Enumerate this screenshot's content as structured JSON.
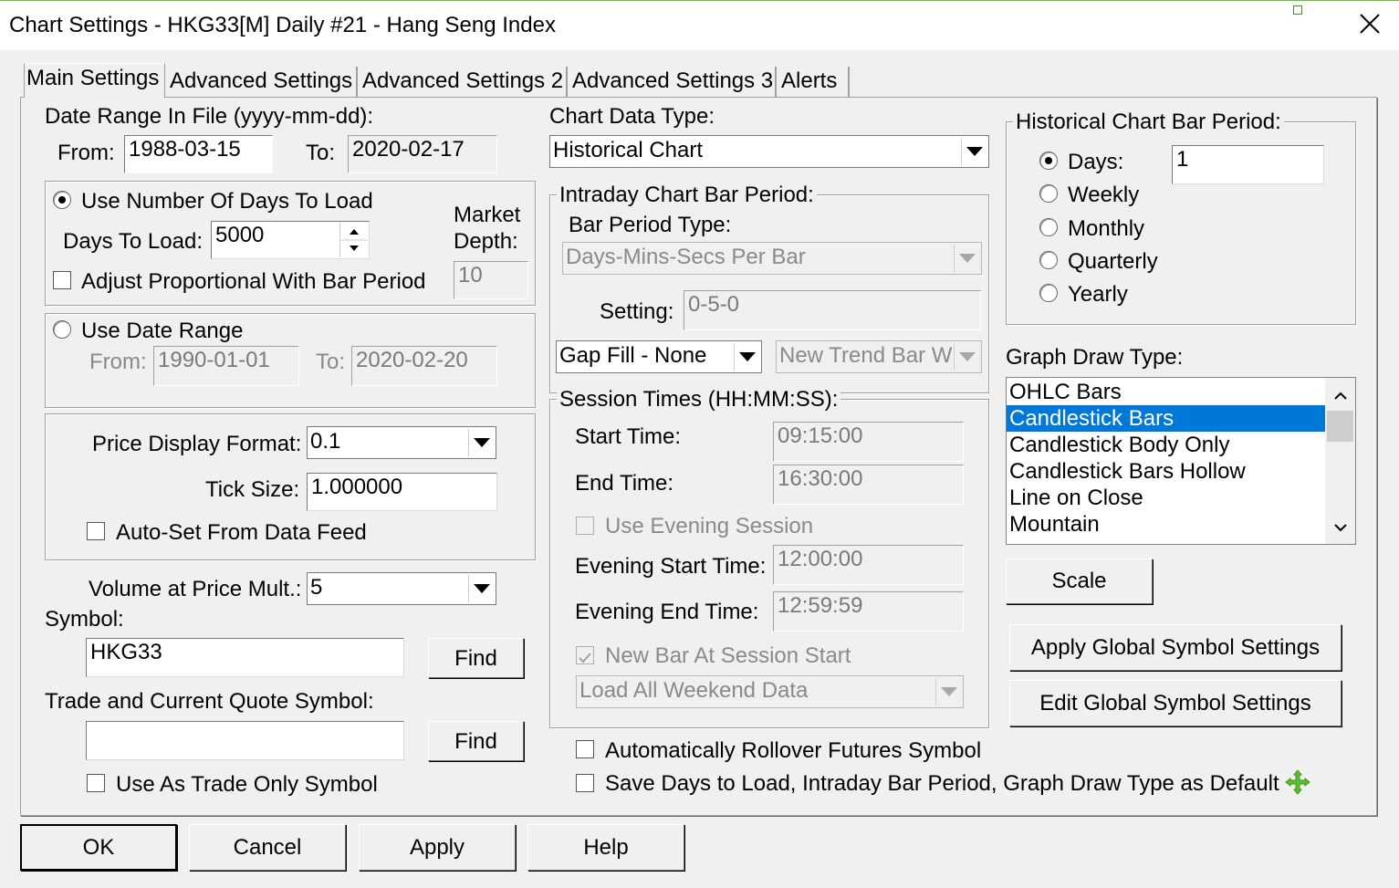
{
  "window": {
    "title": "Chart Settings - HKG33[M]  Daily  #21 - Hang Seng Index"
  },
  "tabs": [
    "Main Settings",
    "Advanced Settings",
    "Advanced Settings 2",
    "Advanced Settings 3",
    "Alerts"
  ],
  "date_range": {
    "label": "Date Range In File (yyyy-mm-dd):",
    "from_label": "From:",
    "from": "1988-03-15",
    "to_label": "To:",
    "to": "2020-02-17"
  },
  "days_group": {
    "use_days_label": "Use Number Of Days To Load",
    "days_label": "Days To Load:",
    "days_value": "5000",
    "market_depth_label_1": "Market",
    "market_depth_label_2": "Depth:",
    "market_depth": "10",
    "adjust_label": "Adjust Proportional With Bar Period"
  },
  "date_range_group": {
    "label": "Use Date Range",
    "from_label": "From:",
    "from": "1990-01-01",
    "to_label": "To:",
    "to": "2020-02-20"
  },
  "price_group": {
    "format_label": "Price Display Format:",
    "format_value": "0.1",
    "tick_label": "Tick Size:",
    "tick_value": "1.000000",
    "autoset_label": "Auto-Set From Data Feed"
  },
  "volume": {
    "label": "Volume at Price Mult.:",
    "value": "5"
  },
  "symbol": {
    "label": "Symbol:",
    "value": "HKG33",
    "find": "Find"
  },
  "trade_symbol": {
    "label": "Trade and Current Quote Symbol:",
    "value": "",
    "find": "Find",
    "trade_only_label": "Use As Trade Only Symbol"
  },
  "chart_data_type": {
    "label": "Chart Data Type:",
    "value": "Historical Chart"
  },
  "intraday": {
    "label": "Intraday Chart Bar Period:",
    "bar_type_label": "Bar Period Type:",
    "bar_type_value": "Days-Mins-Secs Per Bar",
    "setting_label": "Setting:",
    "setting_value": "0-5-0",
    "gap_fill": "Gap Fill - None",
    "new_trend": "New Trend Bar W"
  },
  "session": {
    "label": "Session Times (HH:MM:SS):",
    "start_label": "Start Time:",
    "start": "09:15:00",
    "end_label": "End Time:",
    "end": "16:30:00",
    "evening_label": "Use Evening Session",
    "ev_start_label": "Evening Start Time:",
    "ev_start": "12:00:00",
    "ev_end_label": "Evening End Time:",
    "ev_end": "12:59:59",
    "new_bar_label": "New Bar At Session Start",
    "weekend": "Load All Weekend Data"
  },
  "rollover_label": "Automatically Rollover Futures Symbol",
  "save_default_label": "Save Days to Load, Intraday Bar Period, Graph Draw Type as Default",
  "historical": {
    "label": "Historical Chart Bar Period:",
    "days_label": "Days:",
    "days_value": "1",
    "weekly": "Weekly",
    "monthly": "Monthly",
    "quarterly": "Quarterly",
    "yearly": "Yearly"
  },
  "graph_draw": {
    "label": "Graph Draw Type:",
    "items": [
      "OHLC Bars",
      "Candlestick Bars",
      "Candlestick Body Only",
      "Candlestick Bars Hollow",
      "Line on Close",
      "Mountain"
    ],
    "selected": "Candlestick Bars"
  },
  "scale_btn": "Scale",
  "apply_global_btn": "Apply Global Symbol Settings",
  "edit_global_btn": "Edit Global Symbol Settings",
  "footer": {
    "ok": "OK",
    "cancel": "Cancel",
    "apply": "Apply",
    "help": "Help"
  },
  "colors": {
    "selection": "#0078d7",
    "plus_icon": "#5cbf2a"
  }
}
